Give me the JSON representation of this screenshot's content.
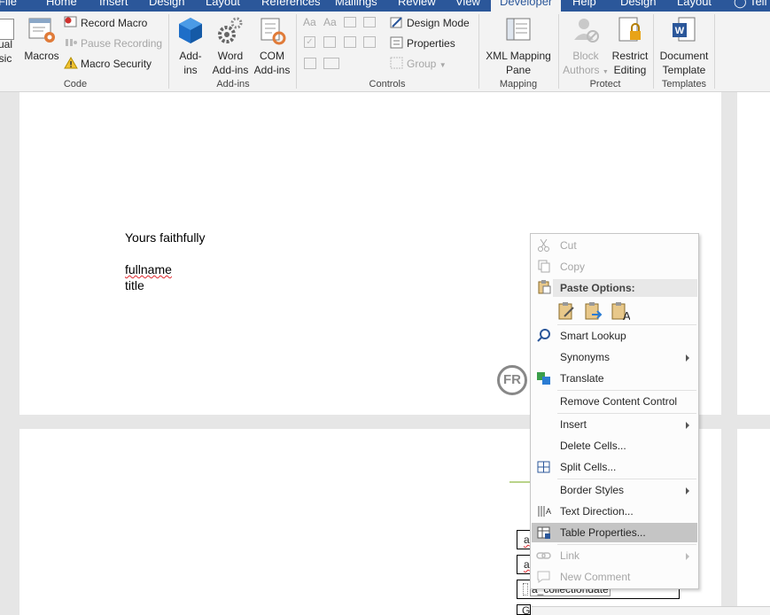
{
  "tabs": [
    {
      "label": "File",
      "active": false
    },
    {
      "label": "Home",
      "active": false
    },
    {
      "label": "Insert",
      "active": false
    },
    {
      "label": "Design",
      "active": false
    },
    {
      "label": "Layout",
      "active": false
    },
    {
      "label": "References",
      "active": false
    },
    {
      "label": "Mailings",
      "active": false
    },
    {
      "label": "Review",
      "active": false
    },
    {
      "label": "View",
      "active": false
    },
    {
      "label": "Developer",
      "active": true
    },
    {
      "label": "Help",
      "active": false
    },
    {
      "label": "Design",
      "active": false
    },
    {
      "label": "Layout",
      "active": false
    },
    {
      "label": "Tell",
      "active": false
    }
  ],
  "ribbon": {
    "code": {
      "label": "Code",
      "visual_basic_1": "sual",
      "visual_basic_2": "asic",
      "macros": "Macros",
      "record_macro": "Record Macro",
      "pause_recording": "Pause Recording",
      "macro_security": "Macro Security"
    },
    "addins": {
      "label": "Add-ins",
      "addins_1": "Add-",
      "addins_2": "ins",
      "word_addins_1": "Word",
      "word_addins_2": "Add-ins",
      "com_addins_1": "COM",
      "com_addins_2": "Add-ins"
    },
    "controls": {
      "label": "Controls",
      "design_mode": "Design Mode",
      "properties": "Properties",
      "group": "Group"
    },
    "mapping": {
      "label": "Mapping",
      "xml_1": "XML Mapping",
      "xml_2": "Pane"
    },
    "protect": {
      "label": "Protect",
      "block_1": "Block",
      "block_2": "Authors",
      "restrict_1": "Restrict",
      "restrict_2": "Editing"
    },
    "templates": {
      "label": "Templates",
      "doc_1": "Document",
      "doc_2": "Template"
    }
  },
  "document": {
    "closing": "Yours faithfully",
    "fullname": "fullname",
    "title": "title",
    "table_cell_1": "a",
    "table_cell_2": "a",
    "table_cell_3": "a_collectiondate",
    "table_cell_4": "G"
  },
  "badge": "FR",
  "context_menu": {
    "cut": "Cut",
    "copy": "Copy",
    "paste_options": "Paste Options:",
    "smart_lookup": "Smart Lookup",
    "synonyms": "Synonyms",
    "translate": "Translate",
    "remove_content_control": "Remove Content Control",
    "insert": "Insert",
    "delete_cells": "Delete Cells...",
    "split_cells": "Split Cells...",
    "border_styles": "Border Styles",
    "text_direction": "Text Direction...",
    "table_properties": "Table Properties...",
    "link": "Link",
    "new_comment": "New Comment"
  },
  "colors": {
    "accent": "#2b579a",
    "ribbon_bg": "#f3f3f3",
    "highlight": "#c5c5c5",
    "disabled": "#a6a6a6"
  }
}
